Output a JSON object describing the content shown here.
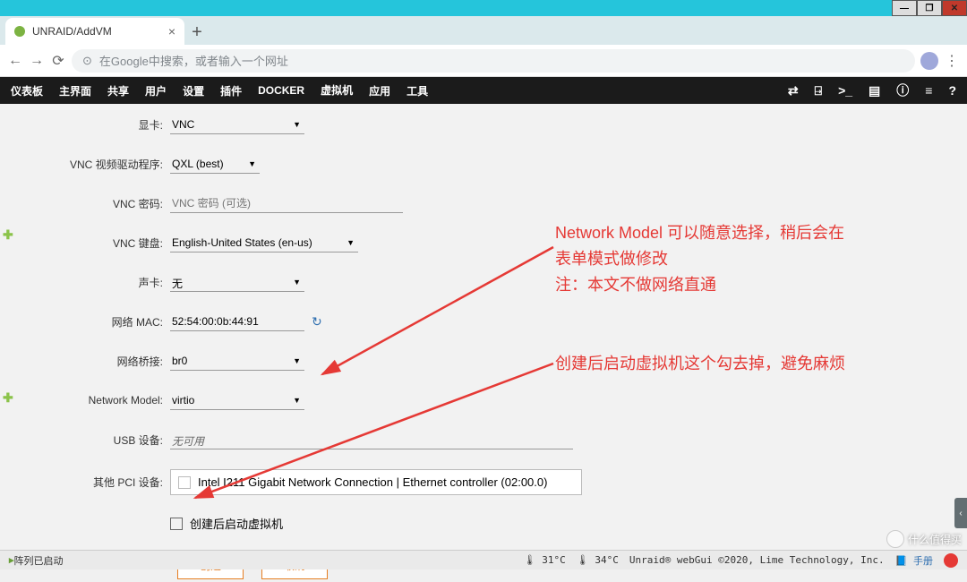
{
  "browser": {
    "tab_title": "UNRAID/AddVM",
    "omnibox_placeholder": "在Google中搜索，或者输入一个网址"
  },
  "nav": {
    "items": [
      "仪表板",
      "主界面",
      "共享",
      "用户",
      "设置",
      "插件",
      "DOCKER",
      "虚拟机",
      "应用",
      "工具"
    ],
    "active_index": 7
  },
  "form": {
    "gpu_label": "显卡:",
    "gpu_value": "VNC",
    "vnc_driver_label": "VNC 视频驱动程序:",
    "vnc_driver_value": "QXL (best)",
    "vnc_pw_label": "VNC 密码:",
    "vnc_pw_placeholder": "VNC 密码 (可选)",
    "vnc_kb_label": "VNC 键盘:",
    "vnc_kb_value": "English-United States (en-us)",
    "sound_label": "声卡:",
    "sound_value": "无",
    "mac_label": "网络 MAC:",
    "mac_value": "52:54:00:0b:44:91",
    "bridge_label": "网络桥接:",
    "bridge_value": "br0",
    "model_label": "Network Model:",
    "model_value": "virtio",
    "usb_label": "USB 设备:",
    "usb_value": "无可用",
    "pci_label": "其他 PCI 设备:",
    "pci_value": "Intel I211 Gigabit Network Connection | Ethernet controller (02:00.0)",
    "autostart_label": "创建后启动虚拟机",
    "create_btn": "创建",
    "cancel_btn": "取消"
  },
  "annotations": {
    "a1_line1": "Network Model 可以随意选择，稍后会在",
    "a1_line2": "表单模式做修改",
    "a1_line3": "注：本文不做网络直通",
    "a2": "创建后启动虚拟机这个勾去掉，避免麻烦"
  },
  "footer": {
    "array": "阵列已启动",
    "temp1": "31°C",
    "temp2": "34°C",
    "copyright": "Unraid® webGui ©2020, Lime Technology, Inc.",
    "manual": "手册"
  },
  "watermark": "什么值得买"
}
